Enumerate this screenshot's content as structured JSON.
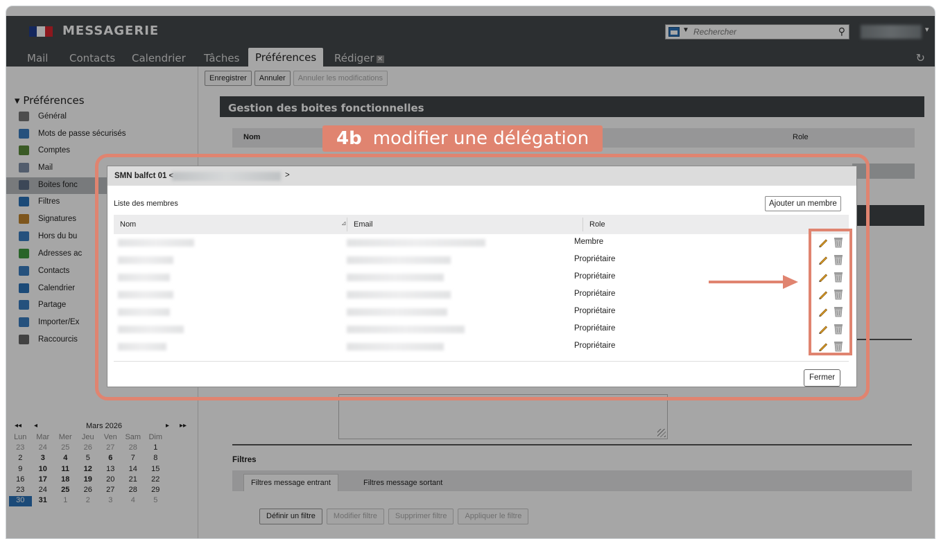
{
  "app": {
    "brand": "MESSAGERIE",
    "flag_colors": [
      "#1f3d8f",
      "#ffffff",
      "#d8262e"
    ]
  },
  "search": {
    "placeholder": "Rechercher"
  },
  "nav": {
    "tabs": [
      "Mail",
      "Contacts",
      "Calendrier",
      "Tâches",
      "Préférences",
      "Rédiger"
    ],
    "active": "Préférences"
  },
  "toolbar": {
    "save": "Enregistrer",
    "cancel": "Annuler",
    "undo": "Annuler les modifications"
  },
  "sidebar": {
    "heading": "Préférences",
    "items": [
      {
        "label": "Général",
        "icon": "gear-icon",
        "color": "#777777"
      },
      {
        "label": "Mots de passe sécurisés",
        "icon": "users-key-icon",
        "color": "#3a7dc0"
      },
      {
        "label": "Comptes",
        "icon": "accounts-icon",
        "color": "#5a8a3a"
      },
      {
        "label": "Mail",
        "icon": "mail-icon",
        "color": "#7f8fa8"
      },
      {
        "label": "Boites fonc",
        "icon": "shared-mailbox-icon",
        "color": "#5d6e86"
      },
      {
        "label": "Filtres",
        "icon": "filter-icon",
        "color": "#2a72b8"
      },
      {
        "label": "Signatures",
        "icon": "signature-icon",
        "color": "#c2852d"
      },
      {
        "label": "Hors du bu",
        "icon": "out-of-office-icon",
        "color": "#3a7dc0"
      },
      {
        "label": "Adresses ac",
        "icon": "shield-icon",
        "color": "#3f9a3f"
      },
      {
        "label": "Contacts",
        "icon": "contact-icon",
        "color": "#3a7dc0"
      },
      {
        "label": "Calendrier",
        "icon": "calendar-icon",
        "color": "#2a72b8"
      },
      {
        "label": "Partage",
        "icon": "share-icon",
        "color": "#3a7dc0"
      },
      {
        "label": "Importer/Ex",
        "icon": "import-export-icon",
        "color": "#3a7dc0"
      },
      {
        "label": "Raccourcis",
        "icon": "shortcut-icon",
        "color": "#666666"
      }
    ],
    "selected_index": 4
  },
  "calendar": {
    "month": "Mars 2026",
    "days_of_week": [
      "Lun",
      "Mar",
      "Mer",
      "Jeu",
      "Ven",
      "Sam",
      "Dim"
    ],
    "weeks": [
      [
        "23",
        "24",
        "25",
        "26",
        "27",
        "28",
        "1"
      ],
      [
        "2",
        "3",
        "4",
        "5",
        "6",
        "7",
        "8"
      ],
      [
        "9",
        "10",
        "11",
        "12",
        "13",
        "14",
        "15"
      ],
      [
        "16",
        "17",
        "18",
        "19",
        "20",
        "21",
        "22"
      ],
      [
        "23",
        "24",
        "25",
        "26",
        "27",
        "28",
        "29"
      ],
      [
        "30",
        "31",
        "1",
        "2",
        "3",
        "4",
        "5"
      ]
    ]
  },
  "main": {
    "section_title": "Gestion des boites fonctionnelles",
    "table_header_nom": "Nom",
    "table_header_role": "Role",
    "filters_label": "Filtres",
    "filter_tabs": [
      "Filtres message entrant",
      "Filtres message sortant"
    ],
    "filter_buttons": [
      "Définir un filtre",
      "Modifier filtre",
      "Supprimer filtre",
      "Appliquer le filtre"
    ]
  },
  "annotation": {
    "number": "4b",
    "text": "modifier une délégation",
    "color": "#e08470"
  },
  "dialog": {
    "title_prefix": "SMN balfct 01 <",
    "title_suffix": ">",
    "list_label": "Liste des membres",
    "add_button": "Ajouter un membre",
    "columns": [
      "Nom",
      "Email",
      "Role"
    ],
    "rows": [
      {
        "role": "Membre"
      },
      {
        "role": "Propriétaire"
      },
      {
        "role": "Propriétaire"
      },
      {
        "role": "Propriétaire"
      },
      {
        "role": "Propriétaire"
      },
      {
        "role": "Propriétaire"
      },
      {
        "role": "Propriétaire"
      }
    ],
    "close_button": "Fermer"
  }
}
